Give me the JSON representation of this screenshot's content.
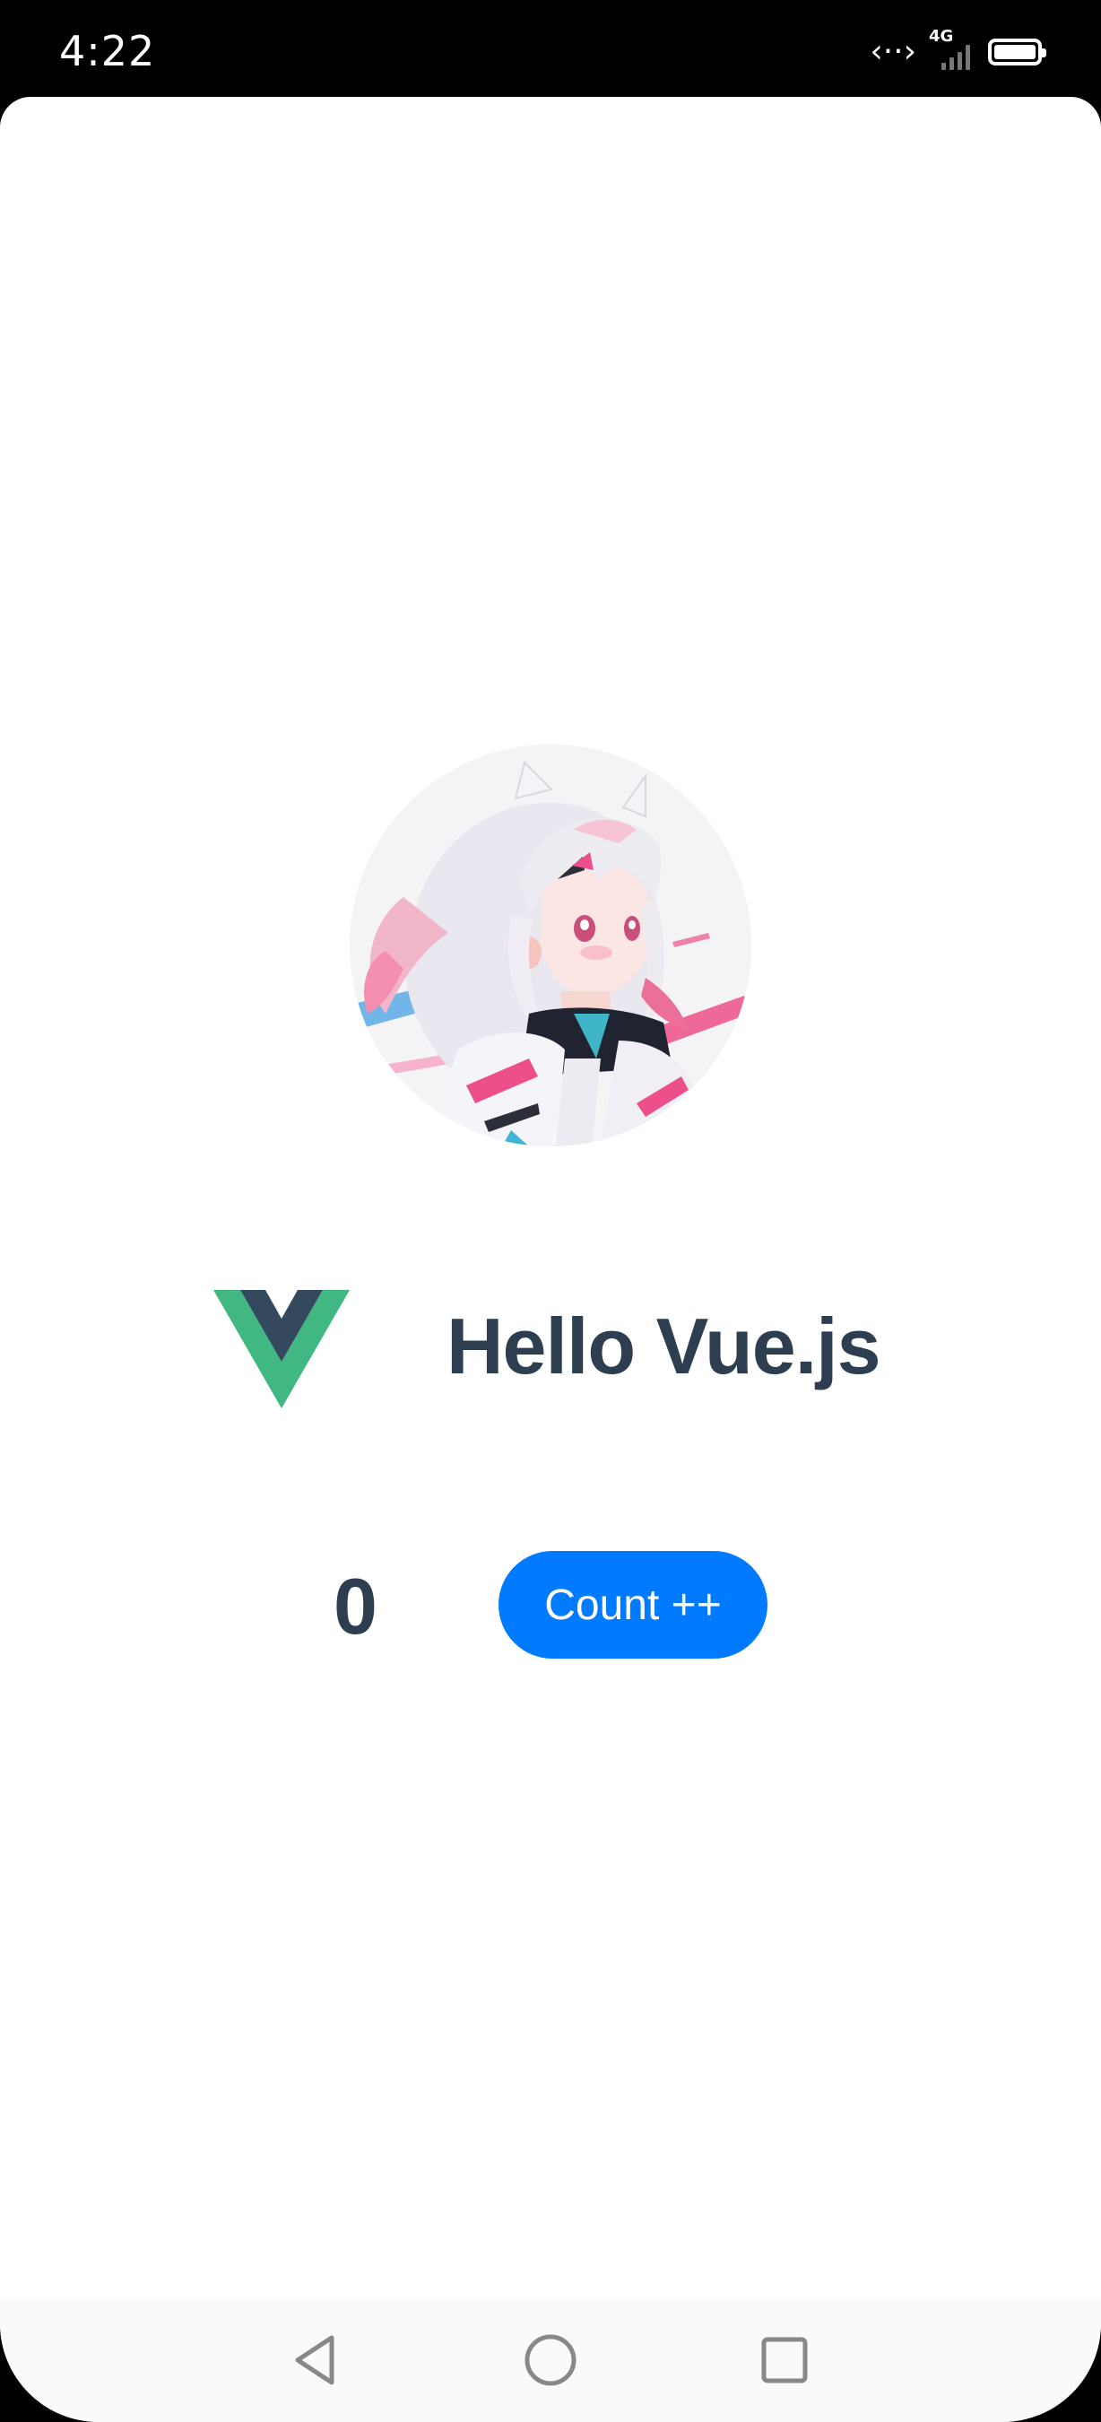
{
  "status_bar": {
    "time": "4:22",
    "network_type": "4G",
    "data_activity_icon": "data-transfer-icon",
    "signal_icon": "cellular-signal-icon",
    "battery_icon": "battery-icon"
  },
  "app": {
    "avatar_icon": "avatar-illustration",
    "logo_icon": "vue-logo-icon",
    "title": "Hello Vue.js",
    "counter": {
      "value": "0",
      "button_label": "Count ++"
    },
    "colors": {
      "primary": "#007aff",
      "text": "#2c3e50",
      "vue_green": "#41b883",
      "vue_dark": "#35495e"
    }
  },
  "nav_bar": {
    "back_icon": "back-triangle-icon",
    "home_icon": "home-circle-icon",
    "recents_icon": "recents-square-icon"
  }
}
